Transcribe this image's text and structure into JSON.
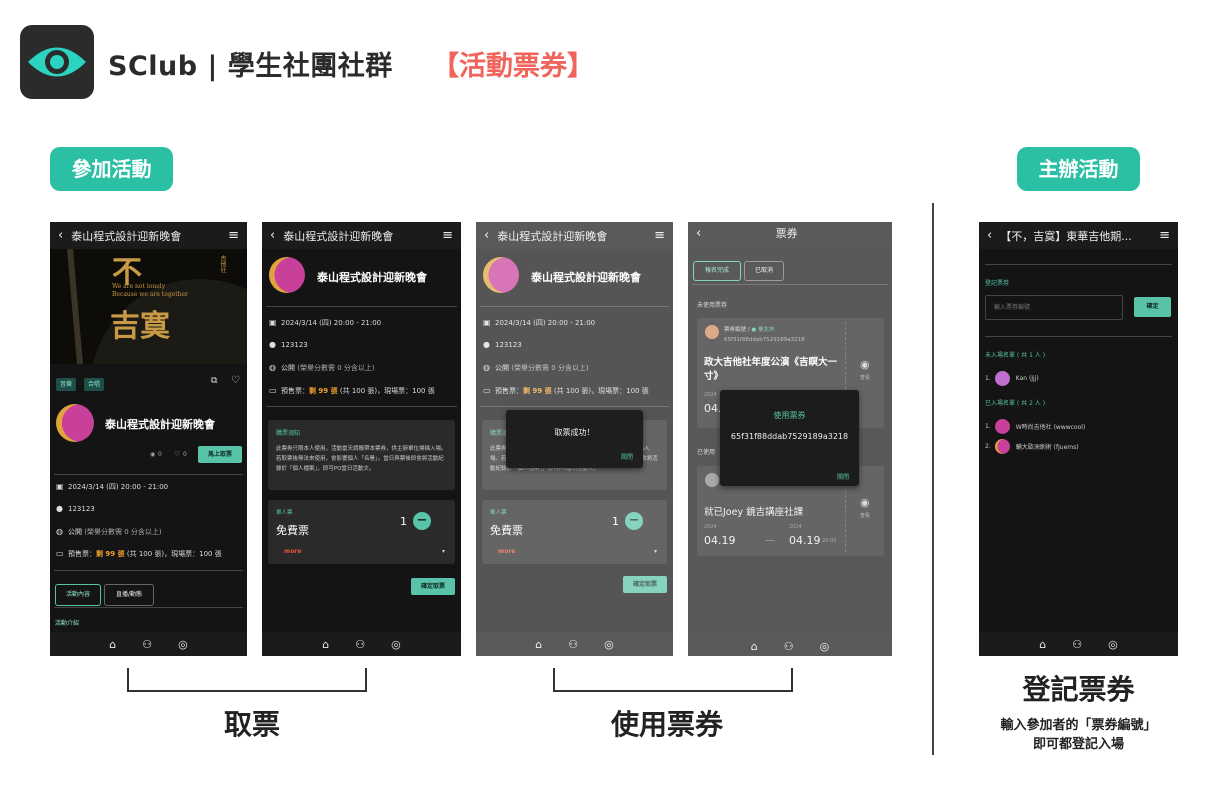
{
  "header": {
    "app_name": "SClub | 學生社團社群",
    "subtitle": "【活動票券】"
  },
  "sections": {
    "join_label": "參加活動",
    "host_label": "主辦活動"
  },
  "event": {
    "name": "泰山程式設計迎新晚會",
    "date": "2024/3/14 (四)  20:00 - 21:00",
    "location": "123123",
    "visibility": "公開",
    "visibility_note": "(榮譽分數需 0 分含以上)",
    "presale_label": "預售票：",
    "presale_remaining": "剩 99 張",
    "presale_total": "(共 100 張)，現場票：100 張",
    "tags": [
      "音樂",
      "合唱"
    ],
    "views": "0",
    "likes": "0",
    "join_button": "馬上取票",
    "poster_big1": "不",
    "poster_big2": "吉寞",
    "poster_en1": "We are not lonely",
    "poster_en2": "Because we are together",
    "poster_side": "吉他社"
  },
  "screen1": {
    "tabs": [
      "活動內容",
      "直播/動態"
    ],
    "intro_label": "活動介紹"
  },
  "screen2": {
    "notice_title": "購票須知",
    "notice_text": "此票券只限本人使用，活動當天請攜帶本票券，供主辦單位掃描入場。若取票後無法來使用，會影響個人「名譽」。當日與票後即會將活動紀錄於「個人檔案」，即可PO當日活動文。",
    "ticket_type_label": "單人票",
    "ticket_name": "免費票",
    "quantity": "1",
    "more": "more",
    "confirm_button": "確定取票"
  },
  "screen3": {
    "modal_text": "取票成功！",
    "modal_close": "關閉"
  },
  "screen4": {
    "title": "票券",
    "tabs": [
      "報名完成",
      "已取消"
    ],
    "unused_label": "未使用票券",
    "used_label": "已使用",
    "ticket1": {
      "code_label": "票券編號",
      "city": "臺北市",
      "code": "65f31f88ddab7529189a3218",
      "title": "政大吉他社年度公演《吉瞑大一寸》",
      "year": "2024",
      "date_partial": "04.",
      "view": "查看"
    },
    "ticket2": {
      "title": "就已Joey 鏡吉講座社課",
      "year_start": "2024",
      "year_end": "2024",
      "start": "04.19",
      "end": "04.19",
      "time": "20:00",
      "view": "查看"
    },
    "modal_title": "使用票券",
    "modal_code": "65f31f88ddab7529189a3218",
    "modal_close": "關閉"
  },
  "screen5": {
    "title": "【不，吉寞】東華吉他期...",
    "register_label": "登記票券",
    "input_placeholder": "輸入票券編號",
    "confirm_button": "確定",
    "not_entered_label": "未入場名單 ( 共 1 人 )",
    "not_entered": [
      {
        "num": "1.",
        "name": "Kan (Jjj)"
      }
    ],
    "entered_label": "已入場名單 ( 共 2 人 )",
    "entered": [
      {
        "num": "1.",
        "name": "W時尚吉他社 (wwwcool)"
      },
      {
        "num": "2.",
        "name": "輔大歐洲劍術 (fjuems)"
      }
    ]
  },
  "captions": {
    "get_ticket": "取票",
    "use_ticket": "使用票券",
    "register_ticket": "登記票券",
    "register_desc1": "輸入參加者的「票券編號」",
    "register_desc2": "即可都登記入場"
  },
  "colors": {
    "teal": "#2bbfa4",
    "accent_red": "#f0645c",
    "orange": "#f0a030",
    "dark_bg": "#141414"
  }
}
